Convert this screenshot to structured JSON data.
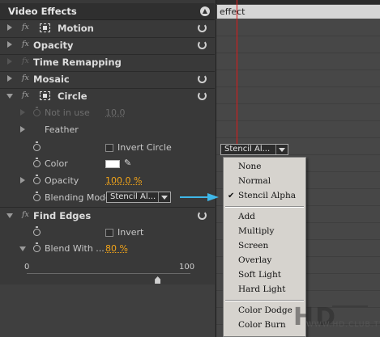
{
  "panel": {
    "title": "Video Effects",
    "effects": [
      {
        "name": "Motion"
      },
      {
        "name": "Opacity"
      },
      {
        "name": "Time Remapping"
      },
      {
        "name": "Mosaic"
      },
      {
        "name": "Circle"
      }
    ],
    "circle": {
      "not_in_use_label": "Not in use",
      "not_in_use_value": "10.0",
      "feather_label": "Feather",
      "invert_circle_label": "Invert Circle",
      "color_label": "Color",
      "color_value": "#FFFFFF",
      "opacity_label": "Opacity",
      "opacity_value": "100.0 %",
      "blending_mode_label": "Blending Mode",
      "blending_mode_value": "Stencil Al..."
    },
    "find_edges": {
      "name": "Find Edges",
      "invert_label": "Invert",
      "blend_label": "Blend With ...",
      "blend_value": "80 %",
      "slider_min": "0",
      "slider_max": "100",
      "slider_fraction": 0.8
    }
  },
  "timeline": {
    "clip_label": "effect",
    "dropdown_value": "Stencil Al..."
  },
  "blend_menu": {
    "items_group1": [
      "None",
      "Normal",
      "Stencil Alpha"
    ],
    "checked_item": "Stencil Alpha",
    "items_group2": [
      "Add",
      "Multiply",
      "Screen",
      "Overlay",
      "Soft Light",
      "Hard Light"
    ],
    "items_group3": [
      "Color Dodge",
      "Color Burn"
    ]
  },
  "watermark": {
    "brand": "HDCLUB",
    "site": "WWW.HD.CLUB.TW"
  },
  "colors": {
    "accent_value": "#F2A419",
    "playhead": "#E01A1A",
    "pointer_arrow": "#3FB7E8"
  }
}
